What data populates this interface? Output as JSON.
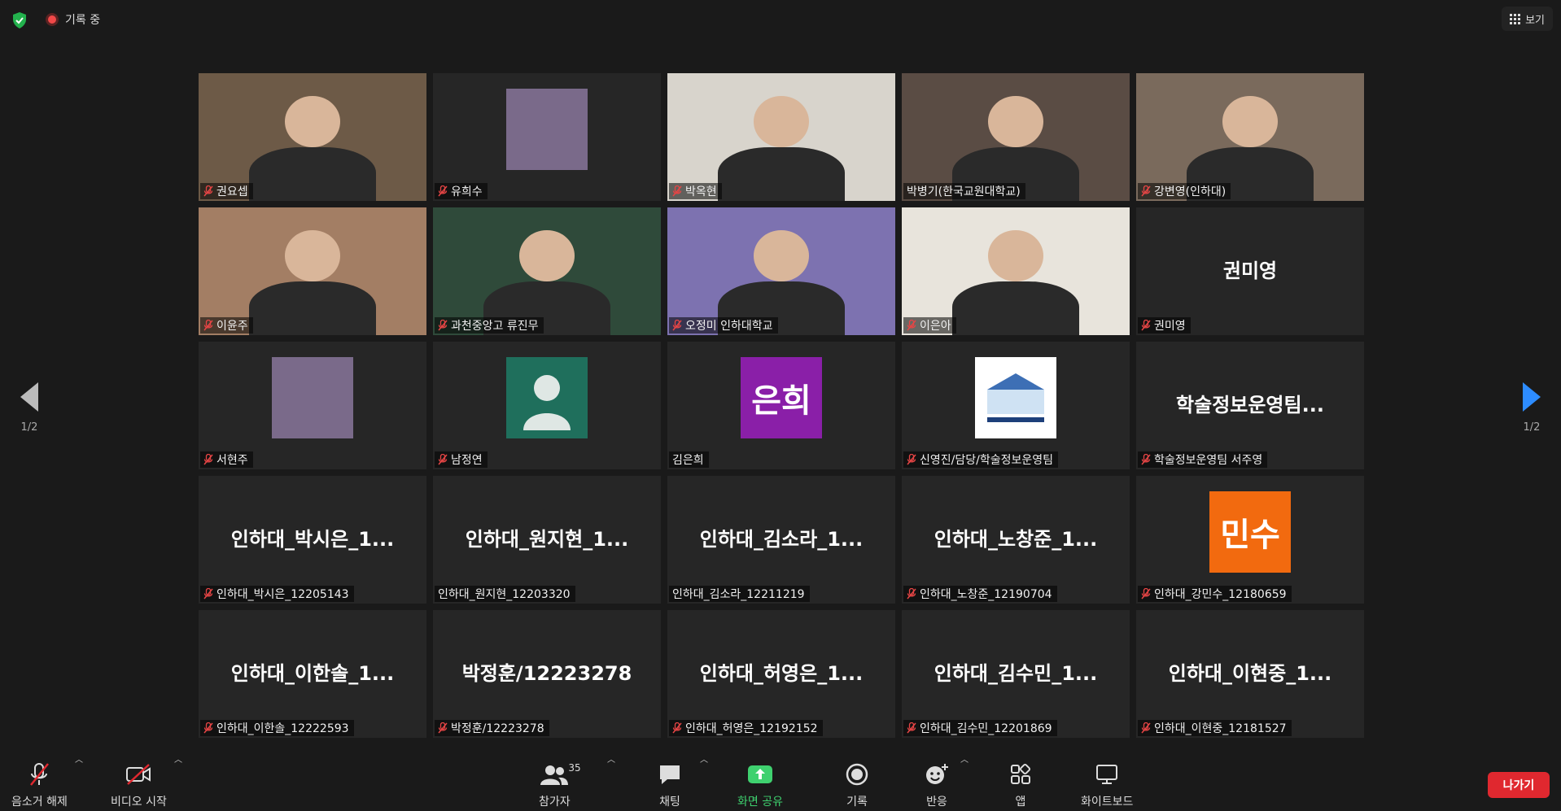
{
  "topbar": {
    "recording_label": "기록 중",
    "view_label": "보기"
  },
  "pagination": {
    "left_label": "1/2",
    "right_label": "1/2"
  },
  "tiles": [
    {
      "name": "권요셉",
      "muted": true,
      "kind": "video"
    },
    {
      "name": "유희수",
      "muted": true,
      "kind": "photo"
    },
    {
      "name": "박옥현",
      "muted": true,
      "kind": "video"
    },
    {
      "name": "박병기(한국교원대학교)",
      "muted": false,
      "kind": "video",
      "speaking": true
    },
    {
      "name": "강변영(인하대)",
      "muted": true,
      "kind": "video"
    },
    {
      "name": "이윤주",
      "muted": true,
      "kind": "video"
    },
    {
      "name": "과천중앙고 류진무",
      "muted": true,
      "kind": "video"
    },
    {
      "name": "오정미 인하대학교",
      "muted": true,
      "kind": "video"
    },
    {
      "name": "이은아",
      "muted": true,
      "kind": "video"
    },
    {
      "name": "권미영",
      "muted": true,
      "kind": "text",
      "display": "권미영"
    },
    {
      "name": "서현주",
      "muted": true,
      "kind": "photo"
    },
    {
      "name": "남정연",
      "muted": true,
      "kind": "avatar-default"
    },
    {
      "name": "김은희",
      "muted": false,
      "kind": "avatar",
      "display": "은희",
      "color": "#8a1fa8"
    },
    {
      "name": "신영진/담당/학술정보운영팀",
      "muted": true,
      "kind": "logo"
    },
    {
      "name": "학술정보운영팀 서주영",
      "muted": true,
      "kind": "text",
      "display": "학술정보운영팀..."
    },
    {
      "name": "인하대_박시은_12205143",
      "muted": true,
      "kind": "text",
      "display": "인하대_박시은_1..."
    },
    {
      "name": "인하대_원지현_12203320",
      "muted": false,
      "kind": "text",
      "display": "인하대_원지현_1..."
    },
    {
      "name": "인하대_김소라_12211219",
      "muted": false,
      "kind": "text",
      "display": "인하대_김소라_1..."
    },
    {
      "name": "인하대_노창준_12190704",
      "muted": true,
      "kind": "text",
      "display": "인하대_노창준_1..."
    },
    {
      "name": "인하대_강민수_12180659",
      "muted": true,
      "kind": "avatar",
      "display": "민수",
      "color": "#f26a0f"
    },
    {
      "name": "인하대_이한솔_12222593",
      "muted": true,
      "kind": "text",
      "display": "인하대_이한솔_1..."
    },
    {
      "name": "박정훈/12223278",
      "muted": true,
      "kind": "text",
      "display": "박정훈/12223278"
    },
    {
      "name": "인하대_허영은_12192152",
      "muted": true,
      "kind": "text",
      "display": "인하대_허영은_1..."
    },
    {
      "name": "인하대_김수민_12201869",
      "muted": true,
      "kind": "text",
      "display": "인하대_김수민_1..."
    },
    {
      "name": "인하대_이현중_12181527",
      "muted": true,
      "kind": "text",
      "display": "인하대_이현중_1..."
    }
  ],
  "toolbar": {
    "unmute_label": "음소거 해제",
    "start_video_label": "비디오 시작",
    "participants_label": "참가자",
    "participants_count": "35",
    "chat_label": "채팅",
    "share_label": "화면 공유",
    "record_label": "기록",
    "reactions_label": "반응",
    "apps_label": "앱",
    "whiteboard_label": "화이트보드",
    "leave_label": "나가기"
  },
  "colors": {
    "background": "#1a1a1a",
    "tile": "#262626",
    "speaking_outline": "#c8d94a",
    "share_green": "#3fd16f",
    "leave_red": "#e0282f",
    "next_arrow": "#2d8cff"
  }
}
